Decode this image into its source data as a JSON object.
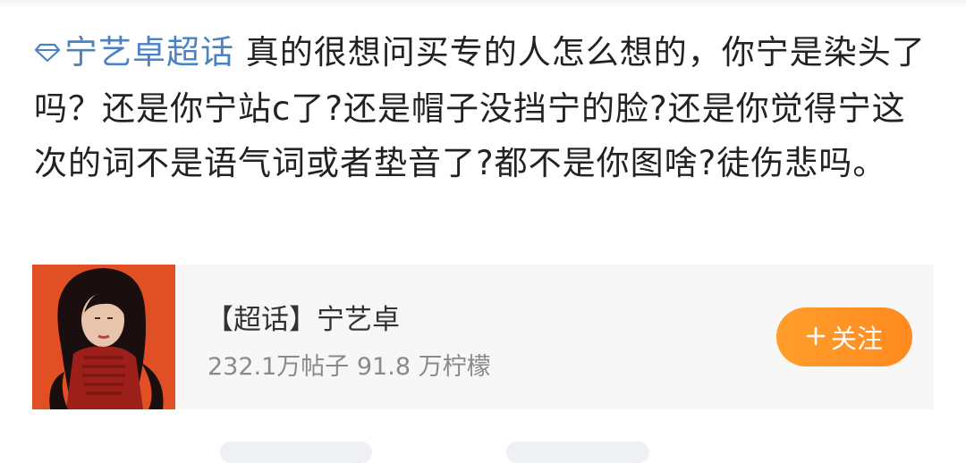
{
  "post": {
    "topic_label": "宁艺卓超话",
    "body": "真的很想问买专的人怎么想的，你宁是染头了吗？还是你宁站c了?还是帽子没挡宁的脸?还是你觉得宁这次的词不是语气词或者垫音了?都不是你图啥?徒伤悲吗。"
  },
  "card": {
    "title": "【超话】宁艺卓",
    "stats": "232.1万帖子 91.8 万柠檬",
    "follow_label": "关注",
    "icons": {
      "diamond": "diamond-icon",
      "plus": "plus-icon"
    }
  },
  "colors": {
    "topic_link": "#4b82c4",
    "follow_button": "#ff9428"
  }
}
